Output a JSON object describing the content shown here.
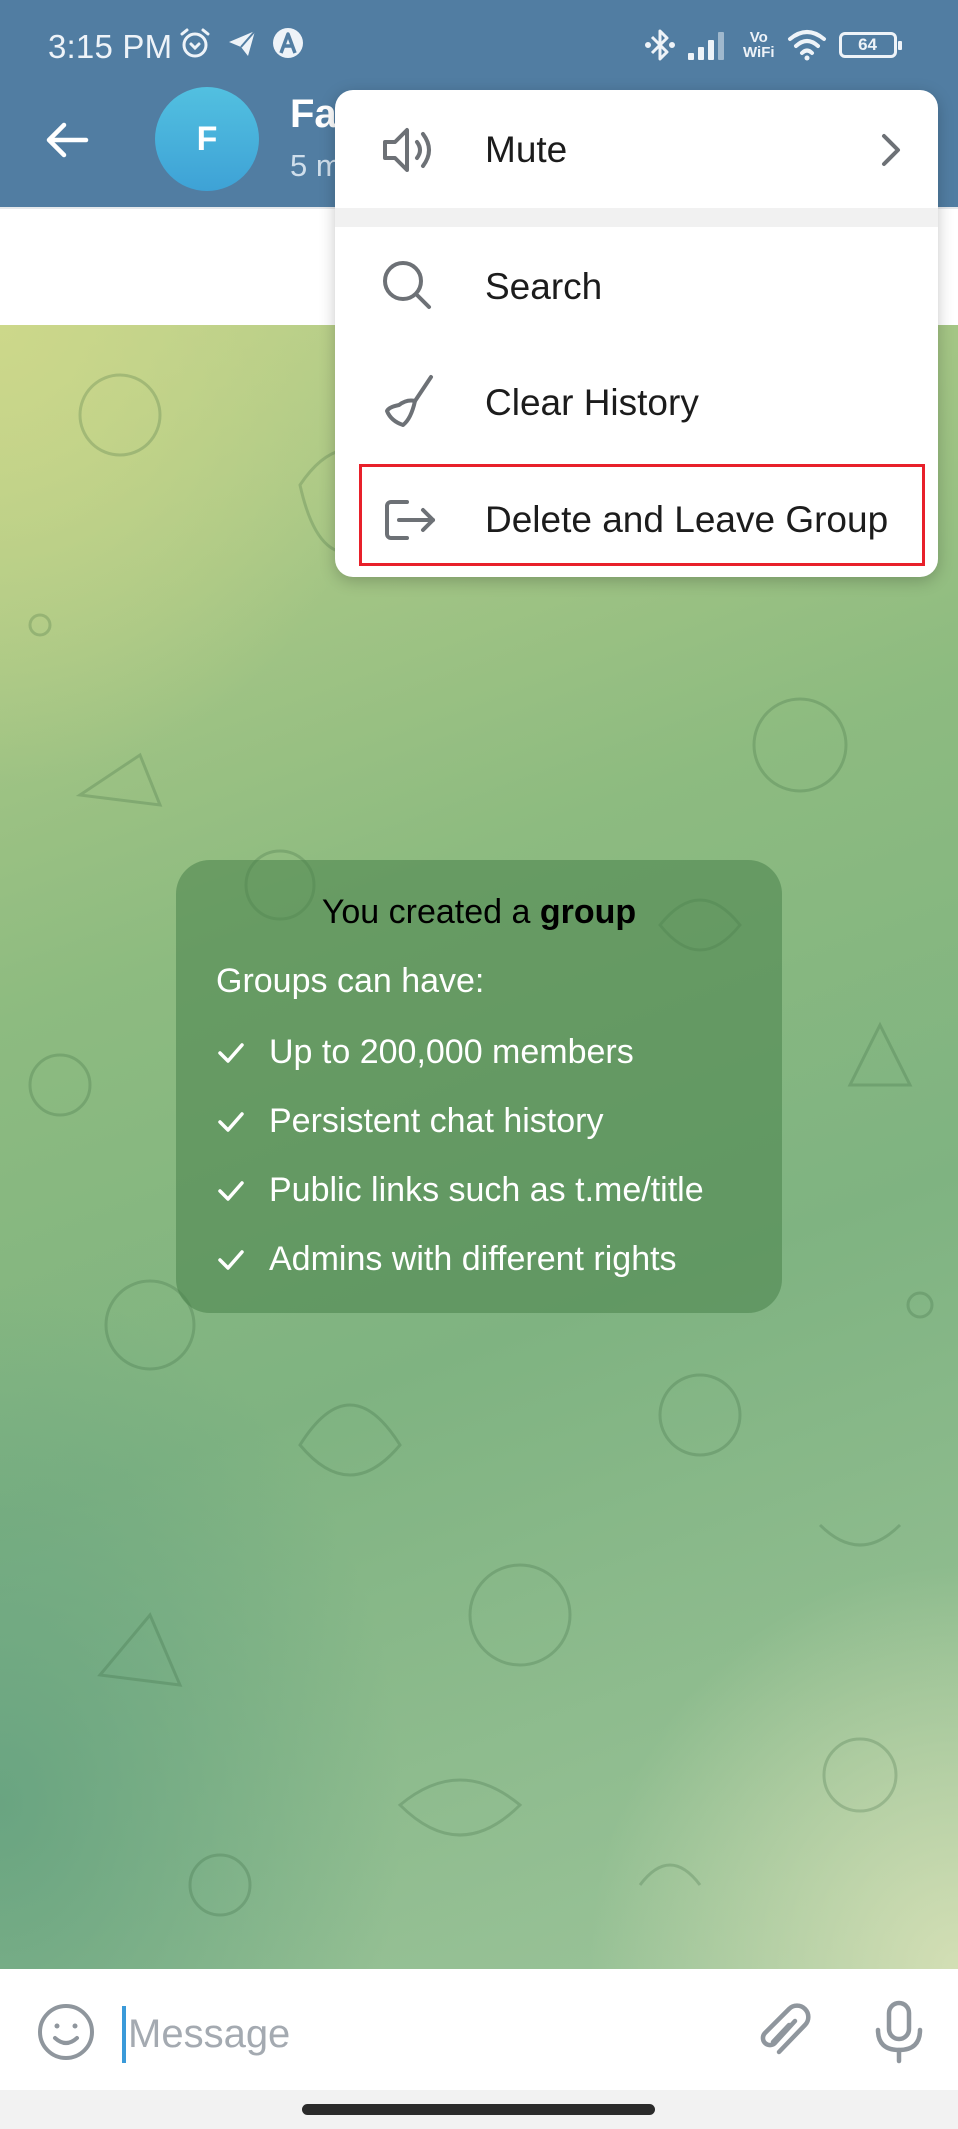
{
  "status_bar": {
    "time": "3:15 PM",
    "left_icons": [
      "alarm-icon",
      "telegram-icon",
      "a-app-icon"
    ],
    "right_icons": [
      "bluetooth-icon",
      "signal-icon",
      "vowifi-icon",
      "wifi-icon",
      "battery-icon"
    ],
    "vowifi_top": "Vo",
    "vowifi_bottom": "WiFi",
    "battery_level": "64"
  },
  "header": {
    "back_icon": "arrow-left-icon",
    "avatar_letter": "F",
    "title_visible": "Fa",
    "subtitle_visible": "5 m",
    "colors": {
      "header_bg": "#517da2",
      "avatar_top": "#52c0e0",
      "avatar_bottom": "#3ea2d6"
    }
  },
  "menu": {
    "items": [
      {
        "label": "Mute",
        "icon": "speaker-icon",
        "has_submenu": true
      },
      {
        "label": "Search",
        "icon": "search-icon",
        "has_submenu": false
      },
      {
        "label": "Clear History",
        "icon": "broom-icon",
        "has_submenu": false
      },
      {
        "label": "Delete and Leave Group",
        "icon": "leave-icon",
        "has_submenu": false,
        "highlighted": true
      }
    ],
    "highlight_color": "#e8202a"
  },
  "info_card": {
    "title_prefix": "You created a ",
    "title_bold": "group",
    "subtitle": "Groups can have:",
    "features": [
      "Up to 200,000 members",
      "Persistent chat history",
      "Public links such as t.me/title",
      "Admins with different rights"
    ]
  },
  "input_bar": {
    "placeholder": "Message",
    "value": "",
    "emoji_icon": "smile-icon",
    "attach_icon": "paperclip-icon",
    "mic_icon": "microphone-icon",
    "cursor_color": "#3a9ad9"
  }
}
